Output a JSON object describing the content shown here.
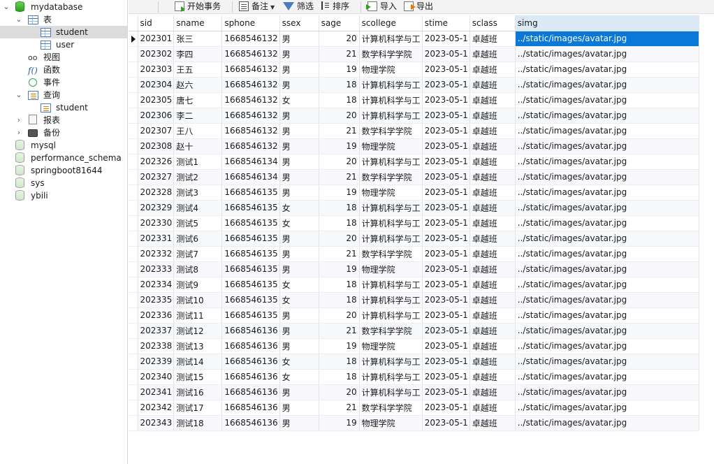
{
  "sidebar": {
    "db_name": "mydatabase",
    "tables_label": "表",
    "tables": [
      "student",
      "user"
    ],
    "views_label": "视图",
    "functions_label": "函数",
    "events_label": "事件",
    "queries_label": "查询",
    "queries": [
      "student"
    ],
    "reports_label": "报表",
    "backups_label": "备份",
    "other_dbs": [
      "mysql",
      "performance_schema",
      "springboot81644",
      "sys",
      "ybili"
    ]
  },
  "toolbar": {
    "begin_tx_label": "开始事务",
    "note_label": "备注",
    "filter_label": "筛选",
    "sort_label": "排序",
    "import_label": "导入",
    "export_label": "导出"
  },
  "grid": {
    "columns": [
      "sid",
      "sname",
      "sphone",
      "ssex",
      "sage",
      "scollege",
      "stime",
      "sclass",
      "simg"
    ],
    "rows": [
      [
        "202301",
        "张三",
        "1668546132",
        "男",
        "20",
        "计算机科学与工",
        "2023-05-1",
        "卓越班",
        "../static/images/avatar.jpg"
      ],
      [
        "202302",
        "李四",
        "1668546132",
        "男",
        "21",
        "数学科学学院",
        "2023-05-1",
        "卓越班",
        "../static/images/avatar.jpg"
      ],
      [
        "202303",
        "王五",
        "1668546132",
        "男",
        "19",
        "物理学院",
        "2023-05-1",
        "卓越班",
        "../static/images/avatar.jpg"
      ],
      [
        "202304",
        "赵六",
        "1668546132",
        "男",
        "18",
        "计算机科学与工",
        "2023-05-1",
        "卓越班",
        "../static/images/avatar.jpg"
      ],
      [
        "202305",
        "唐七",
        "1668546132",
        "女",
        "18",
        "计算机科学与工",
        "2023-05-1",
        "卓越班",
        "../static/images/avatar.jpg"
      ],
      [
        "202306",
        "李二",
        "1668546132",
        "男",
        "20",
        "计算机科学与工",
        "2023-05-1",
        "卓越班",
        "../static/images/avatar.jpg"
      ],
      [
        "202307",
        "王八",
        "1668546132",
        "男",
        "21",
        "数学科学学院",
        "2023-05-1",
        "卓越班",
        "../static/images/avatar.jpg"
      ],
      [
        "202308",
        "赵十",
        "1668546132",
        "男",
        "19",
        "物理学院",
        "2023-05-1",
        "卓越班",
        "../static/images/avatar.jpg"
      ],
      [
        "202326",
        "测试1",
        "1668546134",
        "男",
        "20",
        "计算机科学与工",
        "2023-05-1",
        "卓越班",
        "../static/images/avatar.jpg"
      ],
      [
        "202327",
        "测试2",
        "1668546134",
        "男",
        "21",
        "数学科学学院",
        "2023-05-1",
        "卓越班",
        "../static/images/avatar.jpg"
      ],
      [
        "202328",
        "测试3",
        "1668546135",
        "男",
        "19",
        "物理学院",
        "2023-05-1",
        "卓越班",
        "../static/images/avatar.jpg"
      ],
      [
        "202329",
        "测试4",
        "1668546135",
        "女",
        "18",
        "计算机科学与工",
        "2023-05-1",
        "卓越班",
        "../static/images/avatar.jpg"
      ],
      [
        "202330",
        "测试5",
        "1668546135",
        "女",
        "18",
        "计算机科学与工",
        "2023-05-1",
        "卓越班",
        "../static/images/avatar.jpg"
      ],
      [
        "202331",
        "测试6",
        "1668546135",
        "男",
        "20",
        "计算机科学与工",
        "2023-05-1",
        "卓越班",
        "../static/images/avatar.jpg"
      ],
      [
        "202332",
        "测试7",
        "1668546135",
        "男",
        "21",
        "数学科学学院",
        "2023-05-1",
        "卓越班",
        "../static/images/avatar.jpg"
      ],
      [
        "202333",
        "测试8",
        "1668546135",
        "男",
        "19",
        "物理学院",
        "2023-05-1",
        "卓越班",
        "../static/images/avatar.jpg"
      ],
      [
        "202334",
        "测试9",
        "1668546135",
        "女",
        "18",
        "计算机科学与工",
        "2023-05-1",
        "卓越班",
        "../static/images/avatar.jpg"
      ],
      [
        "202335",
        "测试10",
        "1668546135",
        "女",
        "18",
        "计算机科学与工",
        "2023-05-1",
        "卓越班",
        "../static/images/avatar.jpg"
      ],
      [
        "202336",
        "测试11",
        "1668546135",
        "男",
        "20",
        "计算机科学与工",
        "2023-05-1",
        "卓越班",
        "../static/images/avatar.jpg"
      ],
      [
        "202337",
        "测试12",
        "1668546136",
        "男",
        "21",
        "数学科学学院",
        "2023-05-1",
        "卓越班",
        "../static/images/avatar.jpg"
      ],
      [
        "202338",
        "测试13",
        "1668546136",
        "男",
        "19",
        "物理学院",
        "2023-05-1",
        "卓越班",
        "../static/images/avatar.jpg"
      ],
      [
        "202339",
        "测试14",
        "1668546136",
        "女",
        "18",
        "计算机科学与工",
        "2023-05-1",
        "卓越班",
        "../static/images/avatar.jpg"
      ],
      [
        "202340",
        "测试15",
        "1668546136",
        "女",
        "18",
        "计算机科学与工",
        "2023-05-1",
        "卓越班",
        "../static/images/avatar.jpg"
      ],
      [
        "202341",
        "测试16",
        "1668546136",
        "男",
        "20",
        "计算机科学与工",
        "2023-05-1",
        "卓越班",
        "../static/images/avatar.jpg"
      ],
      [
        "202342",
        "测试17",
        "1668546136",
        "男",
        "21",
        "数学科学学院",
        "2023-05-1",
        "卓越班",
        "../static/images/avatar.jpg"
      ],
      [
        "202343",
        "测试18",
        "1668546136",
        "男",
        "19",
        "物理学院",
        "2023-05-1",
        "卓越班",
        "../static/images/avatar.jpg"
      ]
    ]
  },
  "colors": {
    "selection": "#0a78d7",
    "selected_header": "#dceaf8",
    "selected_tree": "#dcdcdc"
  }
}
